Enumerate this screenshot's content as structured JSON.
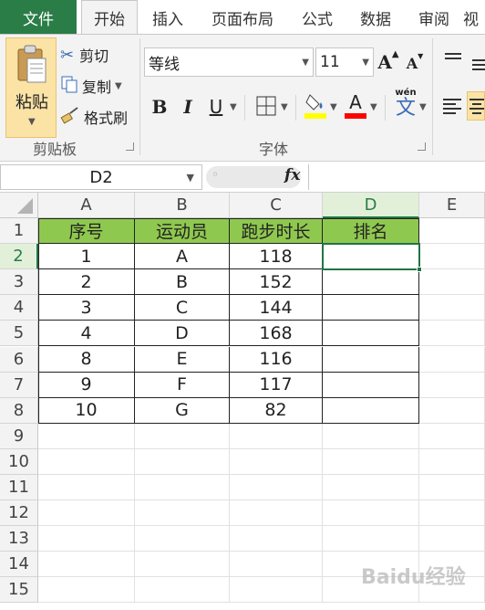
{
  "tabs": {
    "file": "文件",
    "items": [
      "开始",
      "插入",
      "页面布局",
      "公式",
      "数据",
      "审阅",
      "视"
    ]
  },
  "clipboard": {
    "paste": "粘贴",
    "cut": "剪切",
    "copy": "复制",
    "format_painter": "格式刷",
    "group_label": "剪贴板"
  },
  "font": {
    "name": "等线",
    "size": "11",
    "bold": "B",
    "italic": "I",
    "underline": "U",
    "font_color_glyph": "A",
    "phonetic": "wén",
    "phonetic_char": "文",
    "group_label": "字体",
    "highlight_color": "#ffff00",
    "font_color": "#ff0000"
  },
  "formula_bar": {
    "name_box": "D2",
    "fx": "fx",
    "value": ""
  },
  "sheet": {
    "columns": [
      "A",
      "B",
      "C",
      "D",
      "E"
    ],
    "rows": [
      "1",
      "2",
      "3",
      "4",
      "5",
      "6",
      "7",
      "8",
      "9",
      "10",
      "11",
      "12",
      "13",
      "14",
      "15"
    ],
    "selected_cell": "D2",
    "header_fill": "#8fc84f",
    "table_header": [
      "序号",
      "运动员",
      "跑步时长",
      "排名"
    ],
    "table_rows": [
      [
        "1",
        "A",
        "118",
        ""
      ],
      [
        "2",
        "B",
        "152",
        ""
      ],
      [
        "3",
        "C",
        "144",
        ""
      ],
      [
        "4",
        "D",
        "168",
        ""
      ],
      [
        "8",
        "E",
        "116",
        ""
      ],
      [
        "9",
        "F",
        "117",
        ""
      ],
      [
        "10",
        "G",
        "82",
        ""
      ]
    ]
  },
  "watermark": "Baidu经验"
}
